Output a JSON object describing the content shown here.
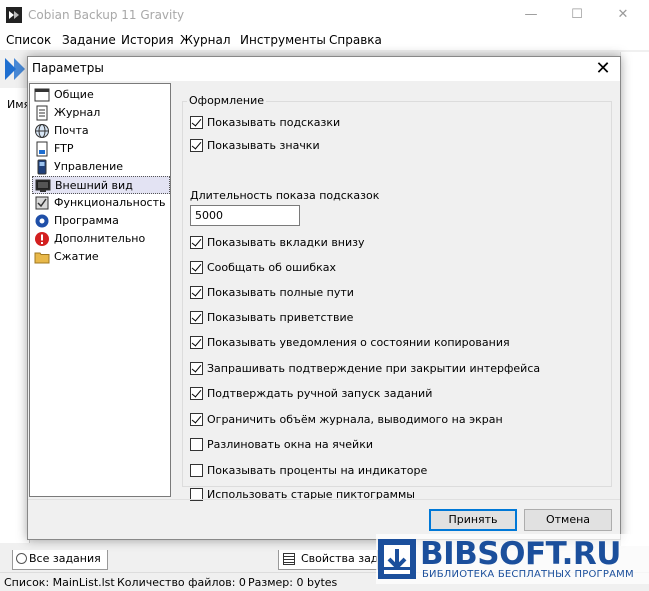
{
  "app": {
    "title": "Cobian Backup 11 Gravity",
    "minimize": "—",
    "maximize": "☐",
    "close": "✕"
  },
  "menu": [
    "Список",
    "Задание",
    "История",
    "Журнал",
    "Инструменты",
    "Справка"
  ],
  "main": {
    "column_name": "Имя",
    "tabs": {
      "all_tasks": "Все задания",
      "task_props": "Свойства задания"
    }
  },
  "status": {
    "list": "Список: MainList.lst",
    "files": "Количество файлов: 0",
    "size": "Размер: 0 bytes"
  },
  "dialog": {
    "title": "Параметры",
    "close": "✕",
    "nav": [
      {
        "label": "Общие",
        "icon": "general-window-icon"
      },
      {
        "label": "Журнал",
        "icon": "log-document-icon"
      },
      {
        "label": "Почта",
        "icon": "mail-globe-icon"
      },
      {
        "label": "FTP",
        "icon": "ftp-document-icon"
      },
      {
        "label": "Управление",
        "icon": "remote-control-icon"
      },
      {
        "label": "Внешний вид",
        "icon": "appearance-monitor-icon"
      },
      {
        "label": "Функциональность",
        "icon": "functionality-icon"
      },
      {
        "label": "Программа",
        "icon": "program-gear-icon"
      },
      {
        "label": "Дополнительно",
        "icon": "advanced-warning-icon"
      },
      {
        "label": "Сжатие",
        "icon": "compression-folder-icon"
      }
    ],
    "selected_nav": "Внешний вид",
    "group_title": "Оформление",
    "options_top": [
      {
        "label": "Показывать подсказки",
        "checked": true
      },
      {
        "label": "Показывать значки",
        "checked": true
      }
    ],
    "tooltip_duration_label": "Длительность показа подсказок",
    "tooltip_duration_value": "5000",
    "options_bottom": [
      {
        "label": "Показывать вкладки внизу",
        "checked": true
      },
      {
        "label": "Сообщать об ошибках",
        "checked": true
      },
      {
        "label": "Показывать полные пути",
        "checked": true
      },
      {
        "label": "Показывать приветствие",
        "checked": true
      },
      {
        "label": "Показывать уведомления о состоянии копирования",
        "checked": true
      },
      {
        "label": "Запрашивать подтверждение при закрытии интерфейса",
        "checked": true
      },
      {
        "label": "Подтверждать ручной запуск заданий",
        "checked": true
      },
      {
        "label": "Ограничить объём журнала, выводимого на экран",
        "checked": true
      },
      {
        "label": "Разлиновать окна на ячейки",
        "checked": false
      },
      {
        "label": "Показывать проценты на индикаторе",
        "checked": false
      },
      {
        "label": "Использовать старые пиктограммы",
        "checked": false
      }
    ],
    "ok": "Принять",
    "cancel": "Отмена"
  },
  "watermark": {
    "title": "BIBSOFT.RU",
    "subtitle": "БИБЛИОТЕКА БЕСПЛАТНЫХ ПРОГРАММ"
  },
  "colors": {
    "accent": "#0078d7",
    "watermark": "#1b4f9c",
    "toolbar_arrow": "#1f6fd0"
  }
}
